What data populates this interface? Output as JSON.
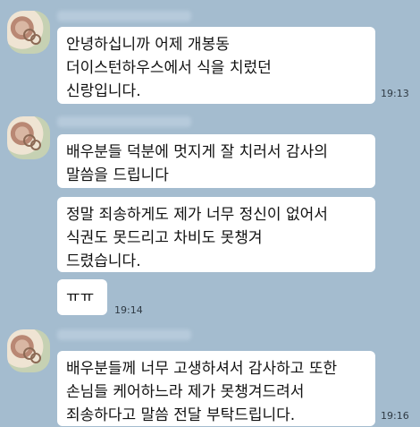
{
  "messages": [
    {
      "text": "안녕하십니까 어제 개봉동\n더이스턴하우스에서 식을 치렀던\n신랑입니다.",
      "time": "19:13"
    },
    {
      "text": "배우분들 덕분에 멋지게 잘 치러서 감사의\n말씀을 드립니다",
      "time": ""
    },
    {
      "text": "정말 죄송하게도 제가 너무 정신이 없어서\n식권도 못드리고 차비도 못챙겨\n드렸습니다.",
      "time": ""
    },
    {
      "text": "ㅠㅠ",
      "time": "19:14"
    },
    {
      "text": "배우분들께 너무 고생하셔서 감사하고 또한\n손님들 케어하느라 제가 못챙겨드려서\n죄송하다고 말씀 전달 부탁드립니다.",
      "time": "19:16"
    }
  ]
}
